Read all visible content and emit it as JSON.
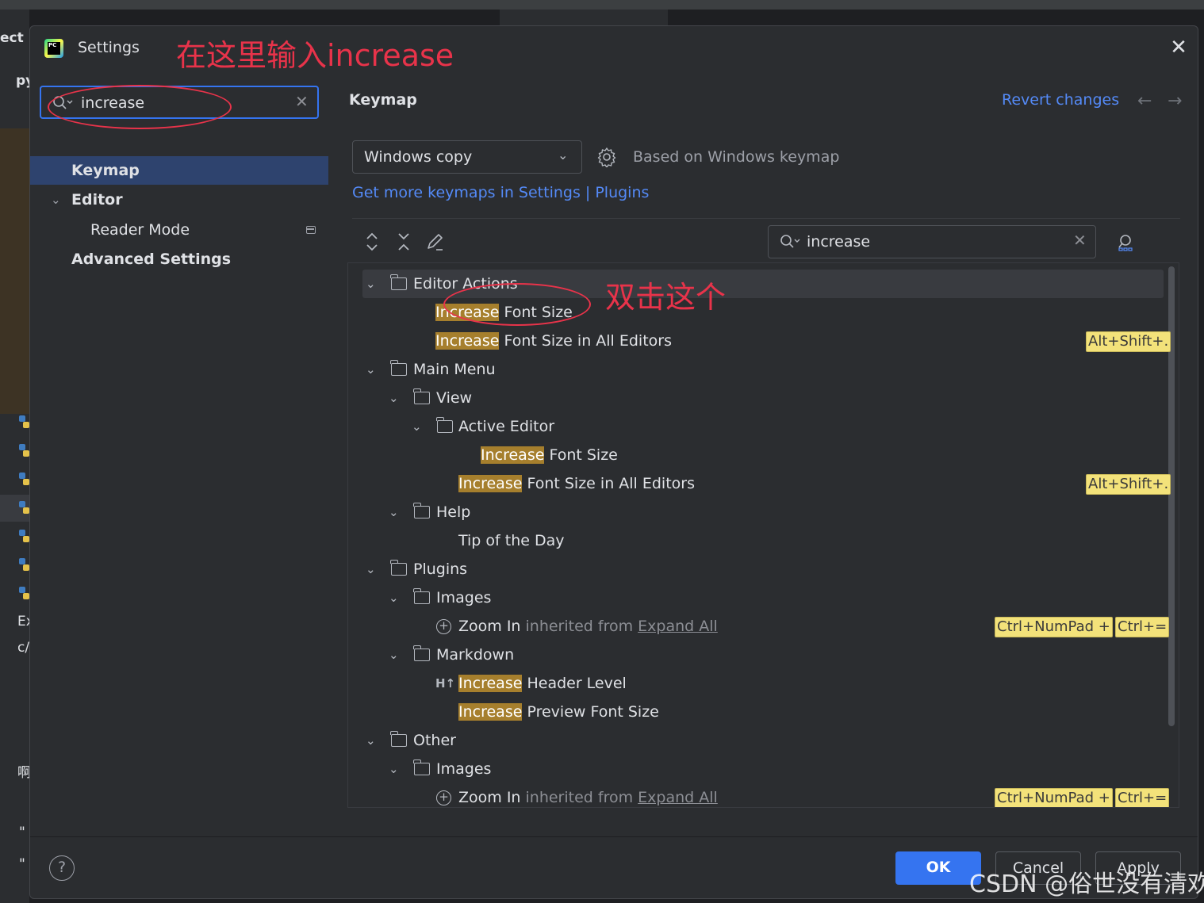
{
  "dialog": {
    "title": "Settings",
    "annotation_top": "在这里输入increase",
    "annotation_tree": "双击这个"
  },
  "ide_bg": {
    "left_texts": [
      "ect",
      "py",
      "Ex",
      "c/",
      "\"",
      "\"",
      "啊"
    ]
  },
  "left_panel": {
    "search_value": "increase",
    "items": [
      {
        "label": "Keymap"
      },
      {
        "label": "Editor"
      },
      {
        "label": "Reader Mode"
      },
      {
        "label": "Advanced Settings"
      }
    ]
  },
  "right_panel": {
    "title": "Keymap",
    "revert": "Revert changes",
    "keymap_value": "Windows copy",
    "based_on": "Based on Windows keymap",
    "more_link": "Get more keymaps in Settings | Plugins",
    "search_value": "increase"
  },
  "tree": [
    {
      "text": "Editor Actions"
    },
    {
      "mark": "Increase",
      "rest": " Font Size"
    },
    {
      "mark": "Increase",
      "rest": " Font Size in All Editors",
      "shortcuts": [
        "Alt+Shift+."
      ]
    },
    {
      "text": "Main Menu"
    },
    {
      "text": "View"
    },
    {
      "text": "Active Editor"
    },
    {
      "mark": "Increase",
      "rest": " Font Size"
    },
    {
      "mark": "Increase",
      "rest": " Font Size in All Editors",
      "shortcuts": [
        "Alt+Shift+."
      ]
    },
    {
      "text": "Help"
    },
    {
      "text": "Tip of the Day"
    },
    {
      "text": "Plugins"
    },
    {
      "text": "Images"
    },
    {
      "text": "Zoom In",
      "dim": " inherited from ",
      "link": "Expand All",
      "shortcuts": [
        "Ctrl+NumPad +",
        "Ctrl+="
      ]
    },
    {
      "text": "Markdown"
    },
    {
      "icon": "H↑",
      "mark": "Increase",
      "rest": " Header Level"
    },
    {
      "mark": "Increase",
      "rest": " Preview Font Size"
    },
    {
      "text": "Other"
    },
    {
      "text": "Images"
    },
    {
      "text": "Zoom In",
      "dim": " inherited from ",
      "link": "Expand All",
      "shortcuts": [
        "Ctrl+NumPad +",
        "Ctrl+="
      ]
    }
  ],
  "footer": {
    "ok": "OK",
    "cancel": "Cancel",
    "apply": "Apply",
    "help": "?",
    "watermark": "CSDN @俗世没有清欢"
  },
  "colors": {
    "accent": "#3574f0",
    "link": "#548af7",
    "highlight": "#a67f2d",
    "annotation": "#e8334a",
    "shortcut_bg": "#f3e27a"
  }
}
